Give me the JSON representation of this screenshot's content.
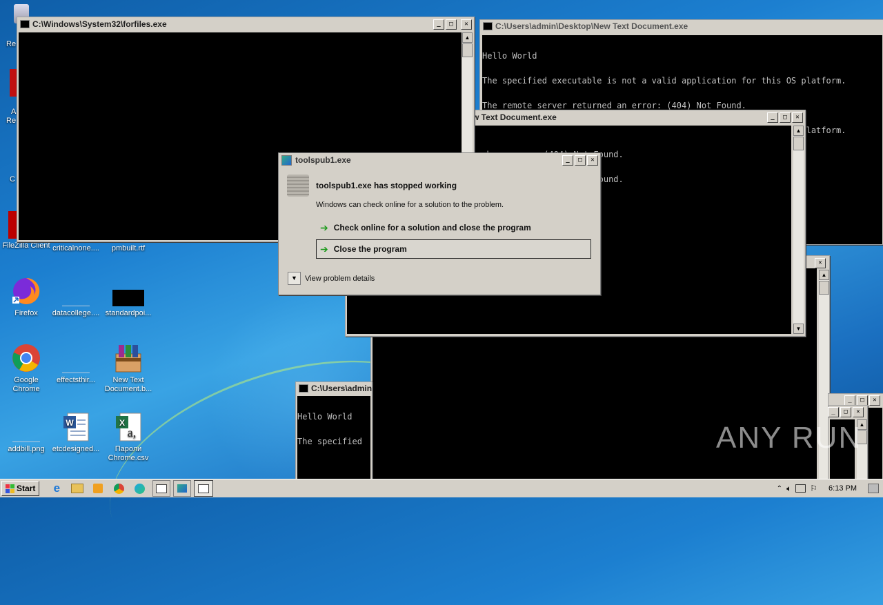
{
  "desktop": {
    "icons": [
      {
        "id": "filezilla",
        "label": "FileZilla Client"
      },
      {
        "id": "criticalnone",
        "label": "criticalnone...."
      },
      {
        "id": "pmbuilt",
        "label": "pmbuilt.rtf"
      },
      {
        "id": "firefox",
        "label": "Firefox"
      },
      {
        "id": "datacollege",
        "label": "datacollege...."
      },
      {
        "id": "standardpoi",
        "label": "standardpoi..."
      },
      {
        "id": "chrome",
        "label": "Google Chrome"
      },
      {
        "id": "effectsthir",
        "label": "effectsthir..."
      },
      {
        "id": "newtextdoc",
        "label": "New Text Document.b..."
      },
      {
        "id": "addbill",
        "label": "addbill.png"
      },
      {
        "id": "etcdesigned",
        "label": "etcdesigned..."
      },
      {
        "id": "paroli",
        "label": "Пароли Chrome.csv"
      }
    ],
    "partial_labels": {
      "re1": "Re",
      "a": "A",
      "re2": "Re",
      "c": "C"
    }
  },
  "windows": {
    "forfiles": {
      "title": "C:\\Windows\\System32\\forfiles.exe"
    },
    "newtext1": {
      "title": "C:\\Users\\admin\\Desktop\\New Text Document.exe",
      "lines": [
        "Hello World",
        "The specified executable is not a valid application for this OS platform.",
        "The remote server returned an error: (404) Not Found.",
        "The specified executable is not a valid application for this OS platform.",
        "The remote server returned an error: (404) Not Found."
      ]
    },
    "newtext2": {
      "title": "w Text Document.exe",
      "lines": [
        "ned an error: (404) Not Found.",
        "ned an error: (404) Not Found."
      ]
    },
    "small": {
      "title": "C:\\Users\\admin",
      "lines": [
        "Hello World",
        "The specified"
      ]
    }
  },
  "dialog": {
    "title": "toolspub1.exe",
    "heading": "toolspub1.exe has stopped working",
    "subtext": "Windows can check online for a solution to the problem.",
    "option_check": "Check online for a solution and close the program",
    "option_close": "Close the program",
    "details": "View problem details"
  },
  "taskbar": {
    "start_label": "Start",
    "clock": "6:13 PM"
  },
  "watermark": "ANY RUN",
  "title_buttons": {
    "min": "_",
    "max": "□",
    "close": "✕"
  }
}
